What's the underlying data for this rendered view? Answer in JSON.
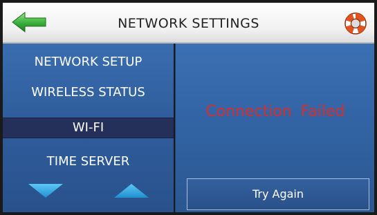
{
  "header": {
    "title": "NETWORK SETTINGS",
    "back_icon": "back-arrow-icon",
    "help_icon": "life-ring-icon"
  },
  "sidebar": {
    "items": [
      {
        "label": "NETWORK SETUP",
        "selected": false
      },
      {
        "label": "WIRELESS STATUS",
        "selected": false
      },
      {
        "label": "WI-FI",
        "selected": true
      },
      {
        "label": "TIME SERVER",
        "selected": false
      }
    ],
    "scroll_down_icon": "triangle-down-icon",
    "scroll_up_icon": "triangle-up-icon"
  },
  "content": {
    "status_text": "Connection Failed",
    "try_again_label": "Try Again"
  },
  "colors": {
    "panel_blue": "#3264a5",
    "selected_bg": "#24305a",
    "error_red": "#d42f2f",
    "back_arrow_green": "#3fb43f",
    "arrow_cyan": "#29a9e6"
  }
}
